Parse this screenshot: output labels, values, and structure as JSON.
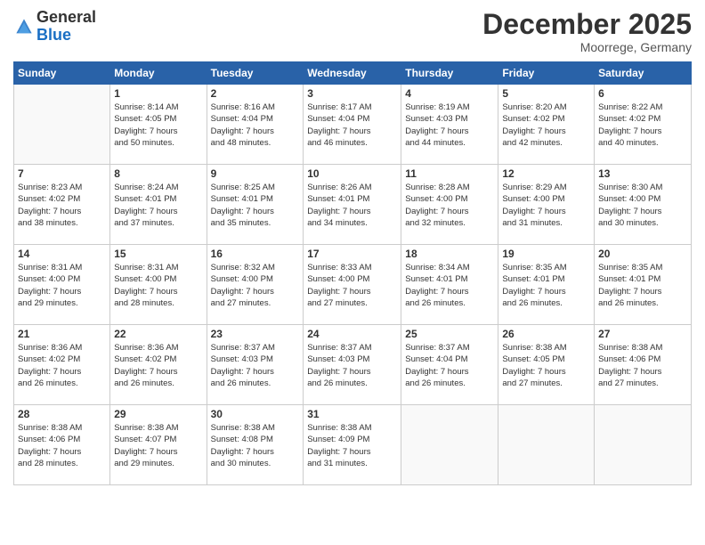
{
  "logo": {
    "general": "General",
    "blue": "Blue"
  },
  "title": "December 2025",
  "location": "Moorrege, Germany",
  "days_header": [
    "Sunday",
    "Monday",
    "Tuesday",
    "Wednesday",
    "Thursday",
    "Friday",
    "Saturday"
  ],
  "weeks": [
    [
      {
        "day": "",
        "info": ""
      },
      {
        "day": "1",
        "info": "Sunrise: 8:14 AM\nSunset: 4:05 PM\nDaylight: 7 hours\nand 50 minutes."
      },
      {
        "day": "2",
        "info": "Sunrise: 8:16 AM\nSunset: 4:04 PM\nDaylight: 7 hours\nand 48 minutes."
      },
      {
        "day": "3",
        "info": "Sunrise: 8:17 AM\nSunset: 4:04 PM\nDaylight: 7 hours\nand 46 minutes."
      },
      {
        "day": "4",
        "info": "Sunrise: 8:19 AM\nSunset: 4:03 PM\nDaylight: 7 hours\nand 44 minutes."
      },
      {
        "day": "5",
        "info": "Sunrise: 8:20 AM\nSunset: 4:02 PM\nDaylight: 7 hours\nand 42 minutes."
      },
      {
        "day": "6",
        "info": "Sunrise: 8:22 AM\nSunset: 4:02 PM\nDaylight: 7 hours\nand 40 minutes."
      }
    ],
    [
      {
        "day": "7",
        "info": "Sunrise: 8:23 AM\nSunset: 4:02 PM\nDaylight: 7 hours\nand 38 minutes."
      },
      {
        "day": "8",
        "info": "Sunrise: 8:24 AM\nSunset: 4:01 PM\nDaylight: 7 hours\nand 37 minutes."
      },
      {
        "day": "9",
        "info": "Sunrise: 8:25 AM\nSunset: 4:01 PM\nDaylight: 7 hours\nand 35 minutes."
      },
      {
        "day": "10",
        "info": "Sunrise: 8:26 AM\nSunset: 4:01 PM\nDaylight: 7 hours\nand 34 minutes."
      },
      {
        "day": "11",
        "info": "Sunrise: 8:28 AM\nSunset: 4:00 PM\nDaylight: 7 hours\nand 32 minutes."
      },
      {
        "day": "12",
        "info": "Sunrise: 8:29 AM\nSunset: 4:00 PM\nDaylight: 7 hours\nand 31 minutes."
      },
      {
        "day": "13",
        "info": "Sunrise: 8:30 AM\nSunset: 4:00 PM\nDaylight: 7 hours\nand 30 minutes."
      }
    ],
    [
      {
        "day": "14",
        "info": "Sunrise: 8:31 AM\nSunset: 4:00 PM\nDaylight: 7 hours\nand 29 minutes."
      },
      {
        "day": "15",
        "info": "Sunrise: 8:31 AM\nSunset: 4:00 PM\nDaylight: 7 hours\nand 28 minutes."
      },
      {
        "day": "16",
        "info": "Sunrise: 8:32 AM\nSunset: 4:00 PM\nDaylight: 7 hours\nand 27 minutes."
      },
      {
        "day": "17",
        "info": "Sunrise: 8:33 AM\nSunset: 4:00 PM\nDaylight: 7 hours\nand 27 minutes."
      },
      {
        "day": "18",
        "info": "Sunrise: 8:34 AM\nSunset: 4:01 PM\nDaylight: 7 hours\nand 26 minutes."
      },
      {
        "day": "19",
        "info": "Sunrise: 8:35 AM\nSunset: 4:01 PM\nDaylight: 7 hours\nand 26 minutes."
      },
      {
        "day": "20",
        "info": "Sunrise: 8:35 AM\nSunset: 4:01 PM\nDaylight: 7 hours\nand 26 minutes."
      }
    ],
    [
      {
        "day": "21",
        "info": "Sunrise: 8:36 AM\nSunset: 4:02 PM\nDaylight: 7 hours\nand 26 minutes."
      },
      {
        "day": "22",
        "info": "Sunrise: 8:36 AM\nSunset: 4:02 PM\nDaylight: 7 hours\nand 26 minutes."
      },
      {
        "day": "23",
        "info": "Sunrise: 8:37 AM\nSunset: 4:03 PM\nDaylight: 7 hours\nand 26 minutes."
      },
      {
        "day": "24",
        "info": "Sunrise: 8:37 AM\nSunset: 4:03 PM\nDaylight: 7 hours\nand 26 minutes."
      },
      {
        "day": "25",
        "info": "Sunrise: 8:37 AM\nSunset: 4:04 PM\nDaylight: 7 hours\nand 26 minutes."
      },
      {
        "day": "26",
        "info": "Sunrise: 8:38 AM\nSunset: 4:05 PM\nDaylight: 7 hours\nand 27 minutes."
      },
      {
        "day": "27",
        "info": "Sunrise: 8:38 AM\nSunset: 4:06 PM\nDaylight: 7 hours\nand 27 minutes."
      }
    ],
    [
      {
        "day": "28",
        "info": "Sunrise: 8:38 AM\nSunset: 4:06 PM\nDaylight: 7 hours\nand 28 minutes."
      },
      {
        "day": "29",
        "info": "Sunrise: 8:38 AM\nSunset: 4:07 PM\nDaylight: 7 hours\nand 29 minutes."
      },
      {
        "day": "30",
        "info": "Sunrise: 8:38 AM\nSunset: 4:08 PM\nDaylight: 7 hours\nand 30 minutes."
      },
      {
        "day": "31",
        "info": "Sunrise: 8:38 AM\nSunset: 4:09 PM\nDaylight: 7 hours\nand 31 minutes."
      },
      {
        "day": "",
        "info": ""
      },
      {
        "day": "",
        "info": ""
      },
      {
        "day": "",
        "info": ""
      }
    ]
  ]
}
